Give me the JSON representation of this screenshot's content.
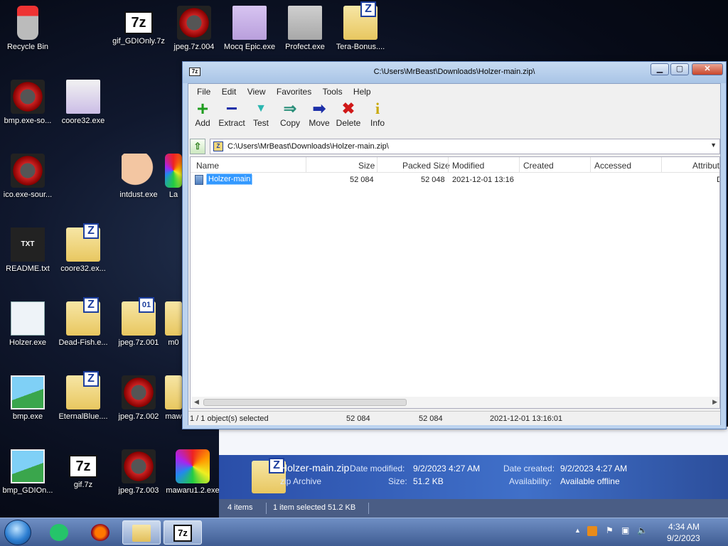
{
  "desktop": {
    "icons": [
      {
        "label": "Recycle Bin",
        "icon": "recycle-bin-icon"
      },
      {
        "label": "gif_GDIOnly.7z",
        "icon": "7z-archive-icon"
      },
      {
        "label": "jpeg.7z.004",
        "icon": "split-archive-icon"
      },
      {
        "label": "Mocq Epic.exe",
        "icon": "anime-app-icon"
      },
      {
        "label": "Profect.exe",
        "icon": "anime-app-icon"
      },
      {
        "label": "Tera-Bonus....",
        "icon": "zip-folder-icon"
      },
      {
        "label": "bmp.exe-so...",
        "icon": "gear-app-icon"
      },
      {
        "label": "coore32.exe",
        "icon": "anime-app-icon"
      },
      {
        "label": "ico.exe-sour...",
        "icon": "gear-app-icon"
      },
      {
        "label": "intdust.exe",
        "icon": "palette-icon"
      },
      {
        "label": "La",
        "icon": "app-icon"
      },
      {
        "label": "README.txt",
        "icon": "text-file-icon"
      },
      {
        "label": "coore32.ex...",
        "icon": "zip-folder-icon"
      },
      {
        "label": "Holzer.exe",
        "icon": "window-app-icon"
      },
      {
        "label": "Dead-Fish.e...",
        "icon": "zip-folder-icon"
      },
      {
        "label": "jpeg.7z.001",
        "icon": "archive-part-icon"
      },
      {
        "label": "m0",
        "icon": "zip-folder-icon"
      },
      {
        "label": "bmp.exe",
        "icon": "image-icon"
      },
      {
        "label": "EternalBlue....",
        "icon": "zip-folder-icon"
      },
      {
        "label": "jpeg.7z.002",
        "icon": "split-archive-icon"
      },
      {
        "label": "maw",
        "icon": "zip-folder-icon"
      },
      {
        "label": "bmp_GDIOn...",
        "icon": "image-icon"
      },
      {
        "label": "gif.7z",
        "icon": "7z-archive-icon"
      },
      {
        "label": "jpeg.7z.003",
        "icon": "split-archive-icon"
      },
      {
        "label": "mawaru1.2.exe",
        "icon": "rainbow-app-icon"
      }
    ]
  },
  "sevenzip": {
    "title": "C:\\Users\\MrBeast\\Downloads\\Holzer-main.zip\\",
    "app_icon": "7z",
    "menu": [
      "File",
      "Edit",
      "View",
      "Favorites",
      "Tools",
      "Help"
    ],
    "toolbar": [
      {
        "label": "Add",
        "glyph": "+",
        "color": "#1f9d1f"
      },
      {
        "label": "Extract",
        "glyph": "−",
        "color": "#1c2fa8"
      },
      {
        "label": "Test",
        "glyph": "▼",
        "color": "#2bb6b0"
      },
      {
        "label": "Copy",
        "glyph": "⇒",
        "color": "#2b8f7a"
      },
      {
        "label": "Move",
        "glyph": "➡",
        "color": "#1c2fa8"
      },
      {
        "label": "Delete",
        "glyph": "✖",
        "color": "#d01818"
      },
      {
        "label": "Info",
        "glyph": "i",
        "color": "#c8a800"
      }
    ],
    "address": "C:\\Users\\MrBeast\\Downloads\\Holzer-main.zip\\",
    "columns": [
      "Name",
      "Size",
      "Packed Size",
      "Modified",
      "Created",
      "Accessed",
      "Attribute"
    ],
    "rows": [
      {
        "name": "Holzer-main",
        "size": "52 084",
        "packed": "52 048",
        "modified": "2021-12-01 13:16",
        "created": "",
        "accessed": "",
        "attribute": "D"
      }
    ],
    "status": {
      "selected": "1 / 1 object(s) selected",
      "size": "52 084",
      "packed": "52 084",
      "modified": "2021-12-01 13:16:01"
    }
  },
  "explorer": {
    "file_name": "Holzer-main.zip",
    "file_type": "zip Archive",
    "date_modified_label": "Date modified:",
    "date_modified": "9/2/2023 4:27 AM",
    "date_created_label": "Date created:",
    "date_created": "9/2/2023 4:27 AM",
    "size_label": "Size:",
    "size": "51.2 KB",
    "availability_label": "Availability:",
    "availability": "Available offline",
    "items_count": "4 items",
    "selection": "1 item selected  51.2 KB"
  },
  "taskbar": {
    "time": "4:34 AM",
    "date": "9/2/2023"
  }
}
